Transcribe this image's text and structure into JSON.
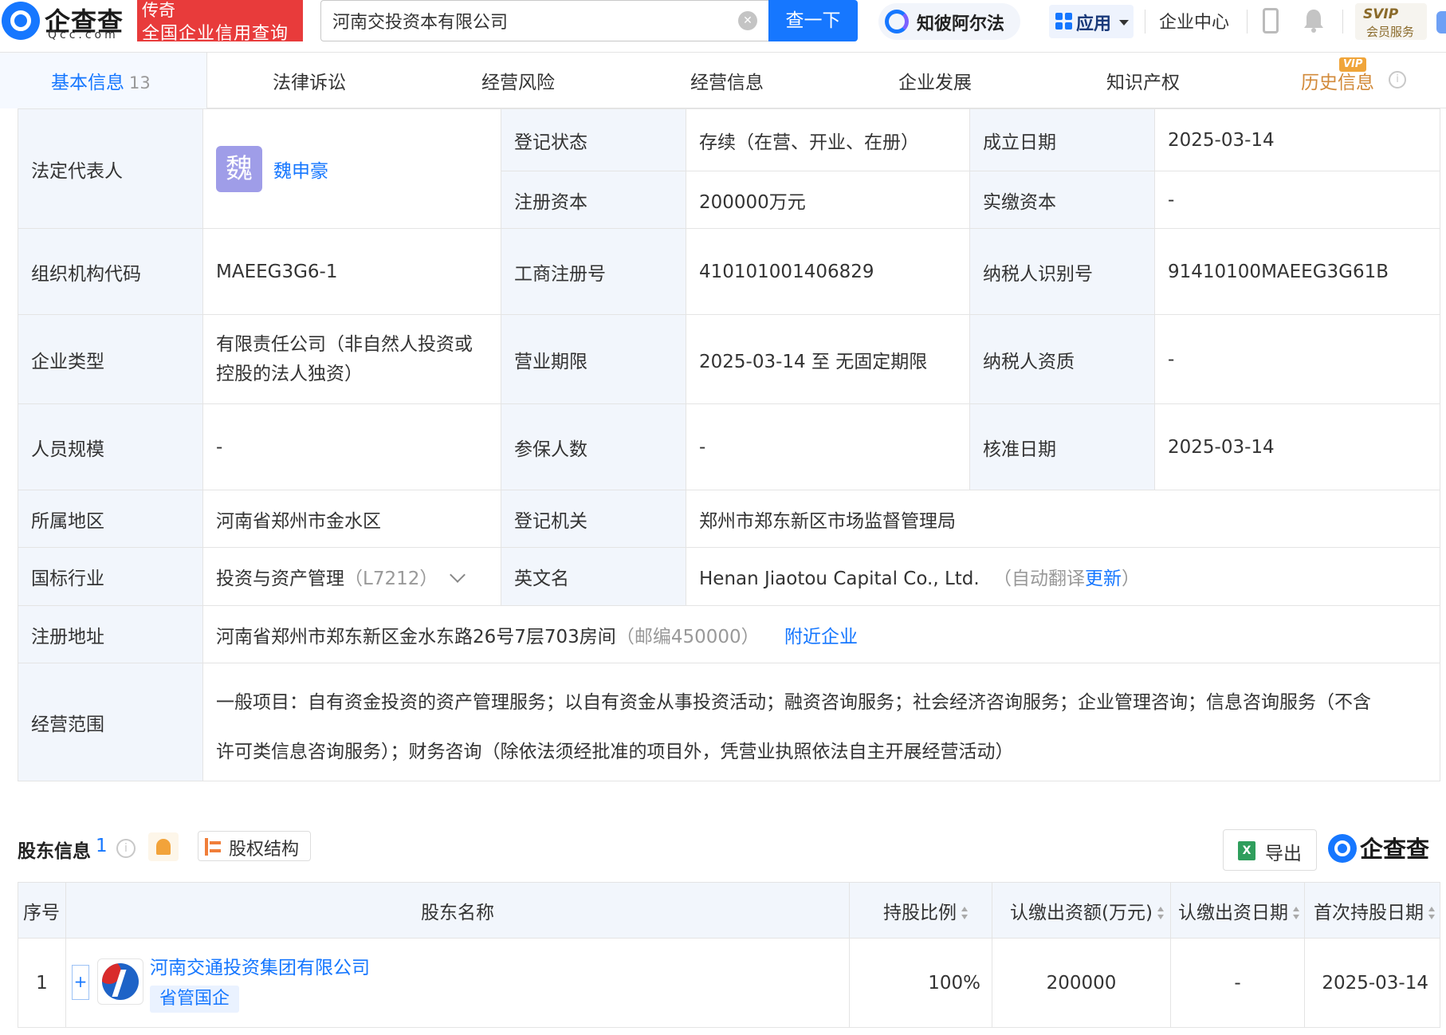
{
  "header": {
    "logo_cn": "企查查",
    "logo_en": "Qcc.com",
    "badge_top": "传奇",
    "badge_bottom": "全国企业信用查询",
    "search_value": "河南交投资本有限公司",
    "search_button": "查一下",
    "zhibi_label": "知彼阿尔法",
    "apps_label": "应用",
    "enterprise_center": "企业中心",
    "svip_label": "SVIP",
    "svip_sub": "会员服务"
  },
  "tabs": {
    "basic": "基本信息",
    "basic_count": "13",
    "legal": "法律诉讼",
    "risk": "经营风险",
    "business": "经营信息",
    "development": "企业发展",
    "ip": "知识产权",
    "history": "历史信息",
    "vip_tag": "VIP"
  },
  "info": {
    "legal_rep_label": "法定代表人",
    "legal_rep_avatar": "魏",
    "legal_rep_name": "魏申豪",
    "reg_status_label": "登记状态",
    "reg_status": "存续（在营、开业、在册）",
    "found_date_label": "成立日期",
    "found_date": "2025-03-14",
    "reg_capital_label": "注册资本",
    "reg_capital": "200000万元",
    "paid_capital_label": "实缴资本",
    "paid_capital": "-",
    "org_code_label": "组织机构代码",
    "org_code": "MAEEG3G6-1",
    "biz_reg_no_label": "工商注册号",
    "biz_reg_no": "410101001406829",
    "tax_id_label": "纳税人识别号",
    "tax_id": "91410100MAEEG3G61B",
    "company_type_label": "企业类型",
    "company_type_line1": "有限责任公司（非自然人投资或",
    "company_type_line2": "控股的法人独资）",
    "term_label": "营业期限",
    "term": "2025-03-14 至 无固定期限",
    "taxpayer_qual_label": "纳税人资质",
    "taxpayer_qual": "-",
    "staff_size_label": "人员规模",
    "staff_size": "-",
    "insured_label": "参保人数",
    "insured": "-",
    "approve_date_label": "核准日期",
    "approve_date": "2025-03-14",
    "region_label": "所属地区",
    "region": "河南省郑州市金水区",
    "authority_label": "登记机关",
    "authority": "郑州市郑东新区市场监督管理局",
    "industry_label": "国标行业",
    "industry": "投资与资产管理",
    "industry_code": "（L7212）",
    "english_name_label": "英文名",
    "english_name": "Henan Jiaotou Capital Co., Ltd.",
    "auto_translate": "（自动翻译",
    "update_link": "更新",
    "auto_translate_end": "）",
    "address_label": "注册地址",
    "address": "河南省郑州市郑东新区金水东路26号7层703房间",
    "postcode": "（邮编450000）",
    "nearby_link": "附近企业",
    "scope_label": "经营范围",
    "scope_line1": "一般项目：自有资金投资的资产管理服务；以自有资金从事投资活动；融资咨询服务；社会经济咨询服务；企业管理咨询；信息咨询服务（不含",
    "scope_line2": "许可类信息咨询服务）；财务咨询（除依法须经批准的项目外，凭营业执照依法自主开展经营活动）"
  },
  "shareholders": {
    "title": "股东信息",
    "count": "1",
    "structure_button": "股权结构",
    "export_button": "导出",
    "excel_icon_text": "X",
    "qcc_mark": "企查查",
    "columns": {
      "seq": "序号",
      "name": "股东名称",
      "ratio": "持股比例",
      "amount": "认缴出资额(万元)",
      "date": "认缴出资日期",
      "first_date": "首次持股日期"
    },
    "rows": [
      {
        "seq": "1",
        "name": "河南交通投资集团有限公司",
        "tag": "省管国企",
        "ratio": "100%",
        "amount": "200000",
        "date": "-",
        "first_date": "2025-03-14"
      }
    ]
  }
}
